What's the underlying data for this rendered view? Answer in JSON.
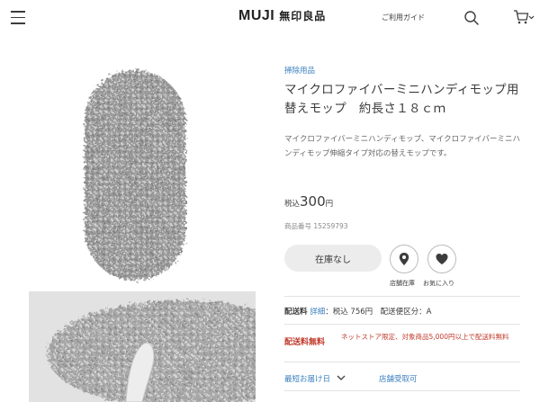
{
  "header": {
    "logo_en": "MUJI",
    "logo_jp": "無印良品",
    "guide_link": "ご利用ガイド"
  },
  "product": {
    "category": "掃除用品",
    "title": "マイクロファイバーミニハンディモップ用替えモップ　約長さ１８ｃｍ",
    "description": "マイクロファイバーミニハンディモップ、マイクロファイバーミニハンディモップ伸縮タイプ対応の替えモップです。",
    "price_tax_label": "税込",
    "price_value": "300",
    "price_unit": "円",
    "code": "商品番号  15259793"
  },
  "actions": {
    "stock_button": "在庫なし",
    "store_stock_caption": "店舗在庫",
    "favorite_caption": "お気に入り"
  },
  "shipping": {
    "label": "配送料",
    "detail_link": "詳細",
    "text": "：税込 756円　配送便区分：A"
  },
  "free_shipping": {
    "title": "配送料無料",
    "note": "ネットストア限定、対象商品5,000円以上で配送料無料"
  },
  "delivery": {
    "fastest_label": "最短お届け日",
    "store_pickup": "店舗受取可"
  },
  "colors": {
    "link": "#3a7fbf",
    "accent_red": "#c0392b",
    "text": "#3c3c3c"
  },
  "icons": [
    "menu-icon",
    "search-icon",
    "cart-icon",
    "chevron-down-icon",
    "map-pin-icon",
    "heart-icon"
  ]
}
